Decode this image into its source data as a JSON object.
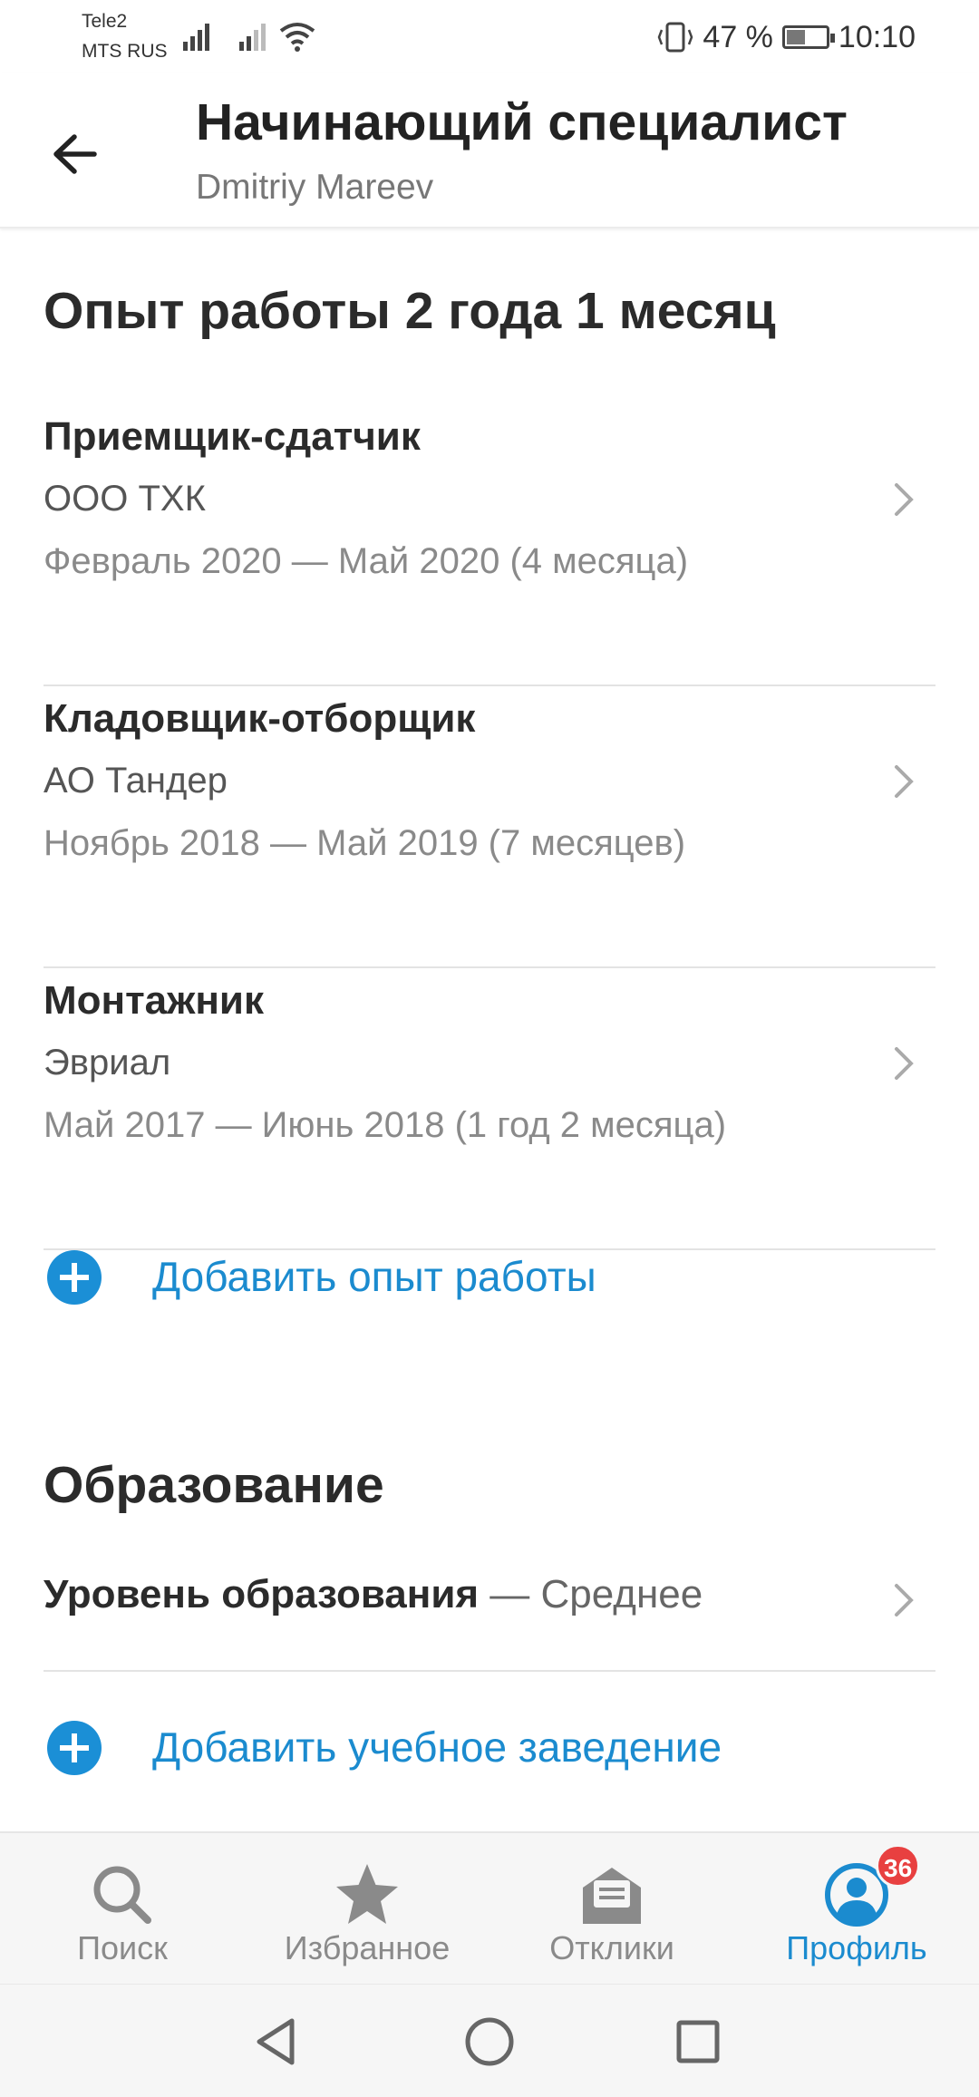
{
  "status_bar": {
    "carrier_1": "Tele2",
    "carrier_2": "MTS RUS",
    "battery_percent": "47 %",
    "battery_level": 0.47,
    "time": "10:10"
  },
  "header": {
    "title": "Начинающий специалист",
    "subtitle": "Dmitriy Mareev"
  },
  "experience": {
    "title": "Опыт работы 2 года 1 месяц",
    "jobs": [
      {
        "position": "Приемщик-сдатчик",
        "company": "ООО ТХК",
        "period": "Февраль 2020 — Май 2020 (4 месяца)"
      },
      {
        "position": "Кладовщик-отборщик",
        "company": "АО Тандер",
        "period": "Ноябрь 2018 — Май 2019 (7 месяцев)"
      },
      {
        "position": "Монтажник",
        "company": "Эвриал",
        "period": "Май 2017 — Июнь 2018 (1 год 2 месяца)"
      }
    ],
    "add_label": "Добавить опыт работы"
  },
  "education": {
    "title": "Образование",
    "level_label": "Уровень образования",
    "level_value": " — Среднее",
    "add_label": "Добавить учебное заведение"
  },
  "bottom_nav": {
    "items": [
      {
        "label": "Поиск",
        "icon": "search-icon"
      },
      {
        "label": "Избранное",
        "icon": "star-icon"
      },
      {
        "label": "Отклики",
        "icon": "responses-icon"
      },
      {
        "label": "Профиль",
        "icon": "profile-icon",
        "badge": "36",
        "active": true
      }
    ]
  },
  "colors": {
    "accent": "#1b8bcf",
    "badge": "#e84040"
  }
}
